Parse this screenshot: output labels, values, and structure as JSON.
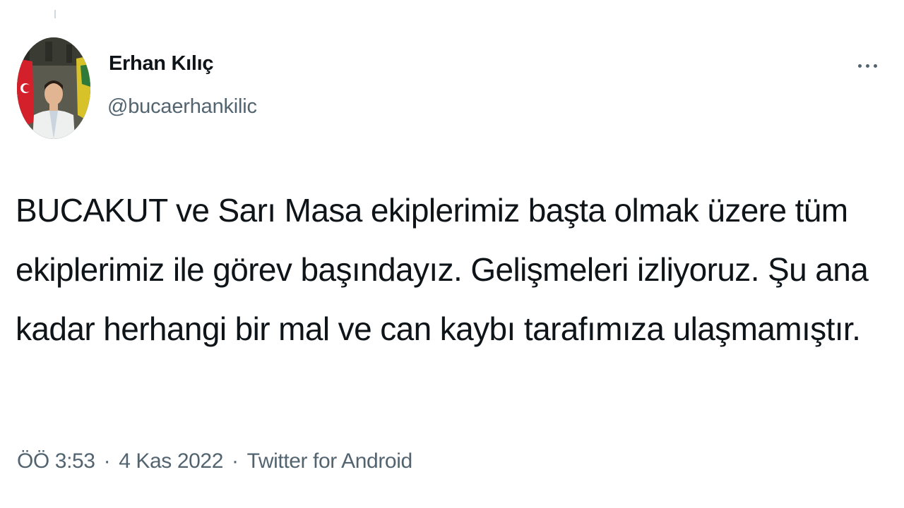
{
  "author": {
    "display_name": "Erhan Kılıç",
    "handle": "@bucaerhankilic"
  },
  "tweet": {
    "text": "BUCAKUT ve Sarı Masa ekiplerimiz başta olmak üzere tüm ekiplerimiz ile görev başındayız. Gelişmeleri izliyoruz. Şu ana kadar herhangi bir mal ve can kaybı tarafımıza ulaşmamıştır."
  },
  "meta": {
    "time": "ÖÖ 3:53",
    "date": "4 Kas 2022",
    "separator": "·",
    "source": "Twitter for Android"
  },
  "icons": {
    "more": "more-dots-icon"
  },
  "colors": {
    "text_primary": "#0f1419",
    "text_secondary": "#536471"
  }
}
